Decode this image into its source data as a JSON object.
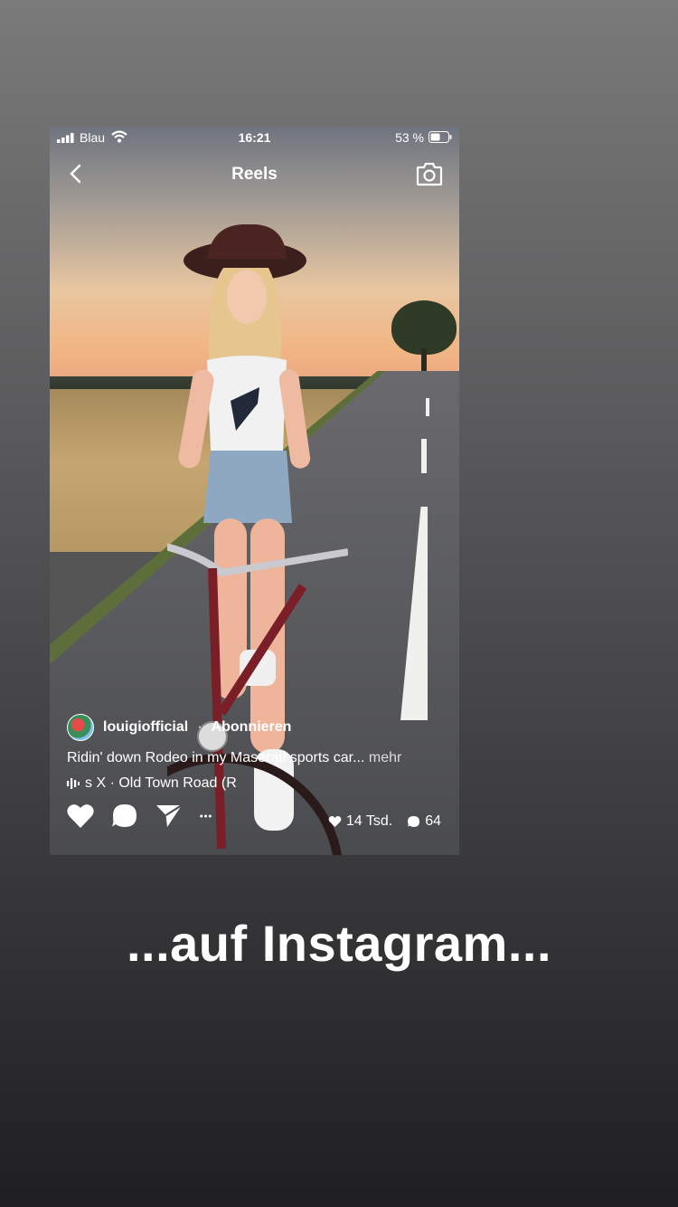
{
  "status_bar": {
    "carrier": "Blau",
    "time": "16:21",
    "battery": "53 %"
  },
  "nav": {
    "title": "Reels"
  },
  "reel": {
    "username": "louigiofficial",
    "separator": "·",
    "subscribe": "Abonnieren",
    "caption": "Ridin' down Rodeo in my Maserati sports car...",
    "more": "mehr",
    "music": "s X · Old Town Road (R",
    "likes": "14 Tsd.",
    "comments": "64"
  },
  "headline": "...auf Instagram...",
  "icons": [
    "signal-icon",
    "wifi-icon",
    "battery-icon",
    "back-icon",
    "camera-icon",
    "music-icon",
    "heart-icon",
    "comment-icon",
    "share-icon",
    "more-icon"
  ]
}
